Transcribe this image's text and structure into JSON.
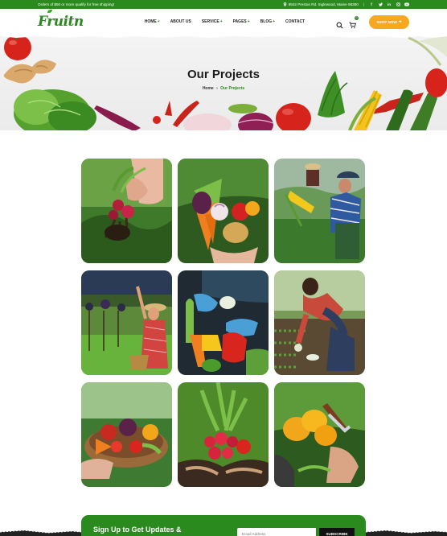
{
  "topbar": {
    "promo": "Orders of $50 or more qualify for free shipping!",
    "address": "9502 Preston Rd. Inglewood, Maine 98380",
    "socials": [
      "facebook-icon",
      "twitter-icon",
      "linkedin-icon",
      "instagram-icon",
      "youtube-icon"
    ]
  },
  "header": {
    "logo": "Fruitn",
    "nav": [
      {
        "label": "HOME",
        "dropdown": true
      },
      {
        "label": "ABOUT US",
        "dropdown": false
      },
      {
        "label": "SERVICE",
        "dropdown": true
      },
      {
        "label": "PAGES",
        "dropdown": true
      },
      {
        "label": "BLOG",
        "dropdown": true
      },
      {
        "label": "CONTACT",
        "dropdown": false
      }
    ],
    "cart_count": "0",
    "shop_button": "SHOP NOW"
  },
  "hero": {
    "title": "Our Projects",
    "breadcrumb_home": "Home",
    "breadcrumb_current": "Our Projects"
  },
  "gallery": [
    "project-tile-radishes",
    "project-tile-vegetable-basket",
    "project-tile-woman-picking",
    "project-tile-vineyard",
    "project-tile-gloved-hands",
    "project-tile-farmer-field",
    "project-tile-harvest-basket",
    "project-tile-radish-bunch",
    "project-tile-peppers-pruning"
  ],
  "newsletter": {
    "title": "Sign Up to Get Updates &",
    "placeholder": "Email Address",
    "button": "SUBSCRIBE"
  },
  "colors": {
    "brand_green": "#2a8a1e",
    "accent_orange": "#f6a91c"
  }
}
